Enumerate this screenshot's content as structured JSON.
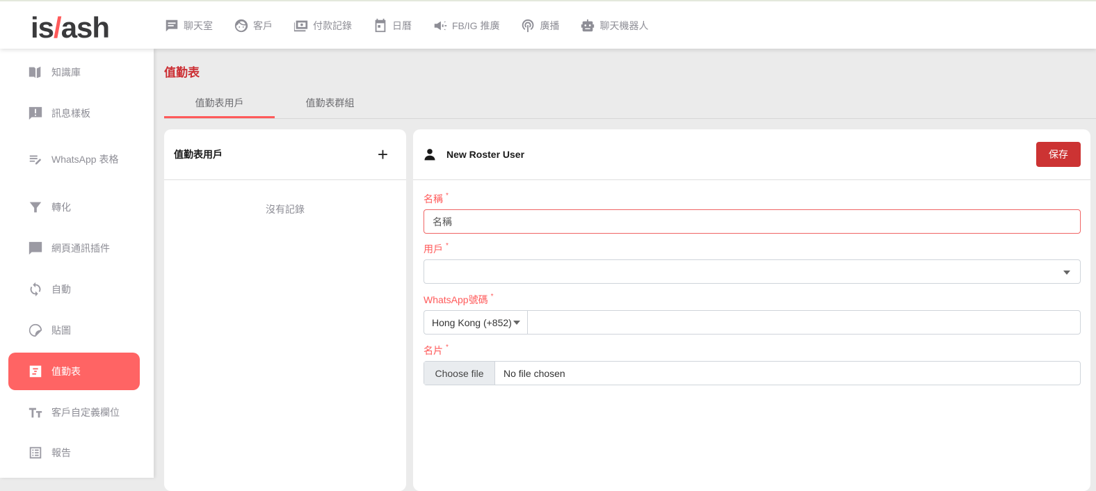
{
  "brand": {
    "logo_text_a": "is",
    "logo_text_b": "/",
    "logo_text_c": "ash"
  },
  "topnav": [
    {
      "label": "聊天室",
      "icon": "chat-icon"
    },
    {
      "label": "客戶",
      "icon": "face-icon"
    },
    {
      "label": "付款記錄",
      "icon": "payment-icon"
    },
    {
      "label": "日曆",
      "icon": "calendar-icon"
    },
    {
      "label": "FB/IG 推廣",
      "icon": "megaphone-icon"
    },
    {
      "label": "廣播",
      "icon": "broadcast-icon"
    },
    {
      "label": "聊天機器人",
      "icon": "robot-icon"
    }
  ],
  "sidebar": [
    {
      "label": "知識庫",
      "icon": "book-icon"
    },
    {
      "label": "訊息樣板",
      "icon": "message-alert-icon"
    },
    {
      "label": "WhatsApp 表格",
      "icon": "form-edit-icon"
    },
    {
      "label": "轉化",
      "icon": "funnel-icon"
    },
    {
      "label": "網頁通訊插件",
      "icon": "comment-icon"
    },
    {
      "label": "自動",
      "icon": "refresh-icon"
    },
    {
      "label": "貼圖",
      "icon": "sticker-icon"
    },
    {
      "label": "值勤表",
      "icon": "roster-icon",
      "active": true
    },
    {
      "label": "客戶自定義欄位",
      "icon": "text-field-icon"
    },
    {
      "label": "報告",
      "icon": "report-icon"
    }
  ],
  "page": {
    "title": "值勤表",
    "tabs": [
      {
        "label": "值勤表用戶",
        "active": true
      },
      {
        "label": "值勤表群組"
      }
    ]
  },
  "list_panel": {
    "title": "值勤表用戶",
    "empty_text": "沒有記錄"
  },
  "form": {
    "title": "New Roster User",
    "save_label": "保存",
    "name_label": "名稱",
    "name_placeholder": "名稱",
    "user_label": "用戶",
    "user_value": "",
    "whatsapp_label": "WhatsApp號碼",
    "country_code": "Hong Kong (+852)",
    "phone_value": "",
    "card_label": "名片",
    "file_button": "Choose file",
    "file_status": "No file chosen",
    "required_mark": "*"
  },
  "colors": {
    "accent": "#ff6464",
    "title": "#cc2f34",
    "save": "#cc3333"
  }
}
